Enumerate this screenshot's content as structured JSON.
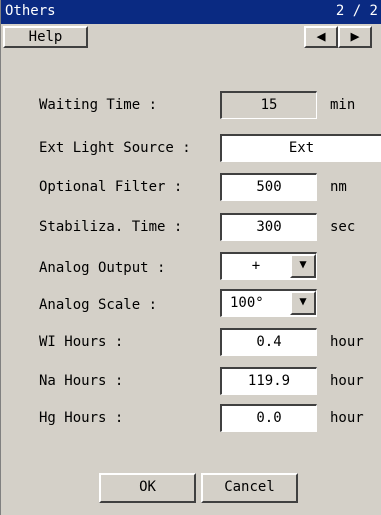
{
  "window": {
    "title": "Others",
    "page_indicator": "2 / 2"
  },
  "toolbar": {
    "help_label": "Help",
    "prev_label": "◀",
    "next_label": "▶"
  },
  "fields": {
    "waiting_time": {
      "label": "Waiting Time :",
      "value": "15",
      "unit": "min"
    },
    "ext_light_source": {
      "label": "Ext Light Source :",
      "value": "Ext"
    },
    "optional_filter": {
      "label": "Optional Filter :",
      "value": "500",
      "unit": "nm"
    },
    "stabiliza_time": {
      "label": "Stabiliza. Time :",
      "value": "300",
      "unit": "sec"
    },
    "analog_output": {
      "label": "Analog Output :",
      "value": "+"
    },
    "analog_scale": {
      "label": "Analog Scale :",
      "value": "100°"
    },
    "wi_hours": {
      "label": "WI Hours :",
      "value": "0.4",
      "unit": "hour"
    },
    "na_hours": {
      "label": "Na Hours :",
      "value": "119.9",
      "unit": "hour"
    },
    "hg_hours": {
      "label": "Hg Hours :",
      "value": "0.0",
      "unit": "hour"
    }
  },
  "buttons": {
    "ok_label": "OK",
    "cancel_label": "Cancel"
  },
  "icons": {
    "dropdown": "triangle-down-icon"
  }
}
